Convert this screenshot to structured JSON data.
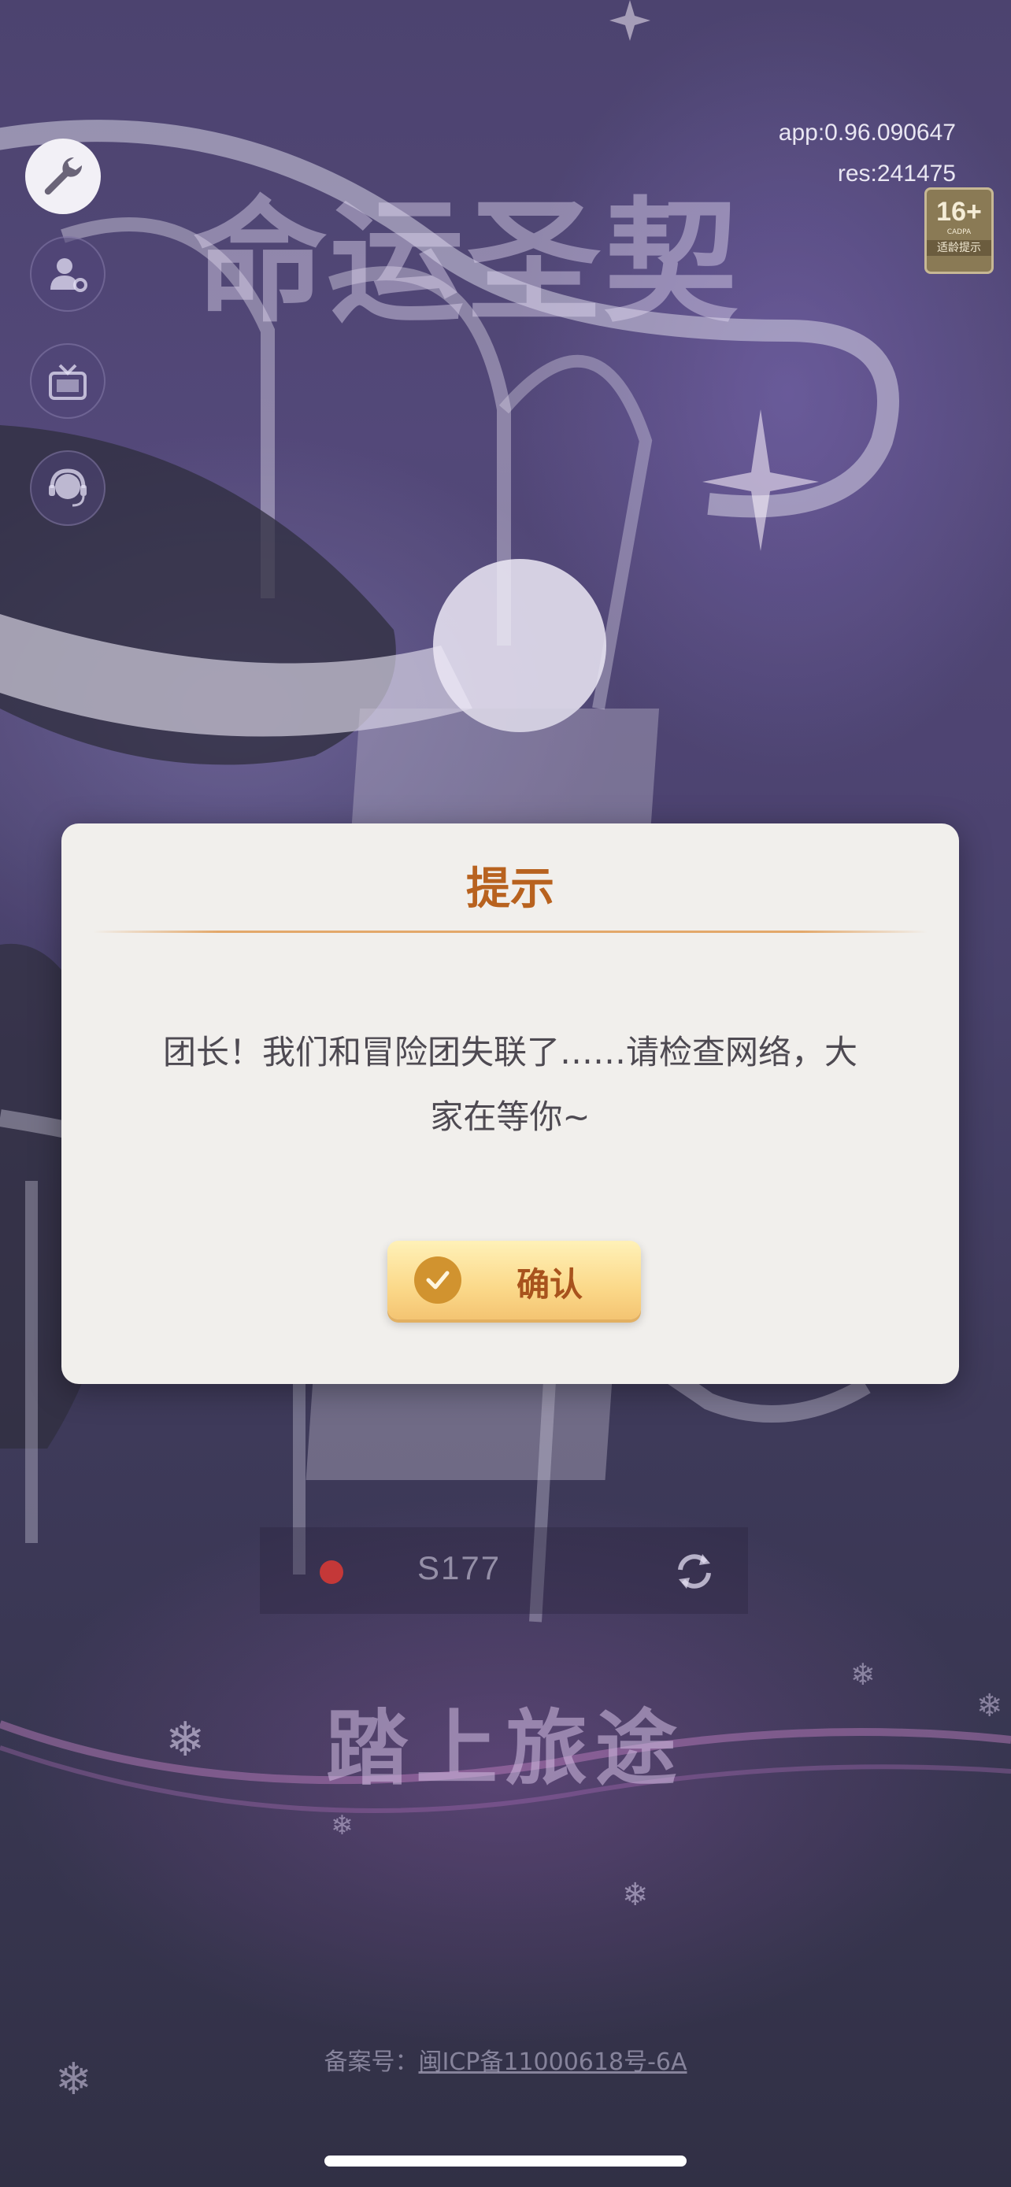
{
  "version": {
    "app": "app:0.96.090647",
    "res": "res:241475"
  },
  "age_rating": {
    "number": "16+",
    "org": "CADPA",
    "label": "适龄提示"
  },
  "game_logo": "命运圣契",
  "side_buttons": [
    {
      "icon": "wrench-icon"
    },
    {
      "icon": "account-settings-icon"
    },
    {
      "icon": "announcement-tv-icon"
    },
    {
      "icon": "customer-service-headset-icon"
    }
  ],
  "dialog": {
    "title": "提示",
    "message": "团长！我们和冒险团失联了……请检查网络，大家在等你~",
    "confirm_label": "确认",
    "confirm_icon": "checkmark-icon"
  },
  "server": {
    "name": "S177",
    "status_color": "#c43838"
  },
  "start_button": "踏上旅途",
  "icp": {
    "prefix": "备案号：",
    "link": "闽ICP备11000618号-6A"
  },
  "colors": {
    "dialog_title": "#b8621f",
    "button_text": "#a8531d",
    "button_gradient_top": "#fff1b8",
    "button_gradient_bottom": "#f4c472"
  }
}
